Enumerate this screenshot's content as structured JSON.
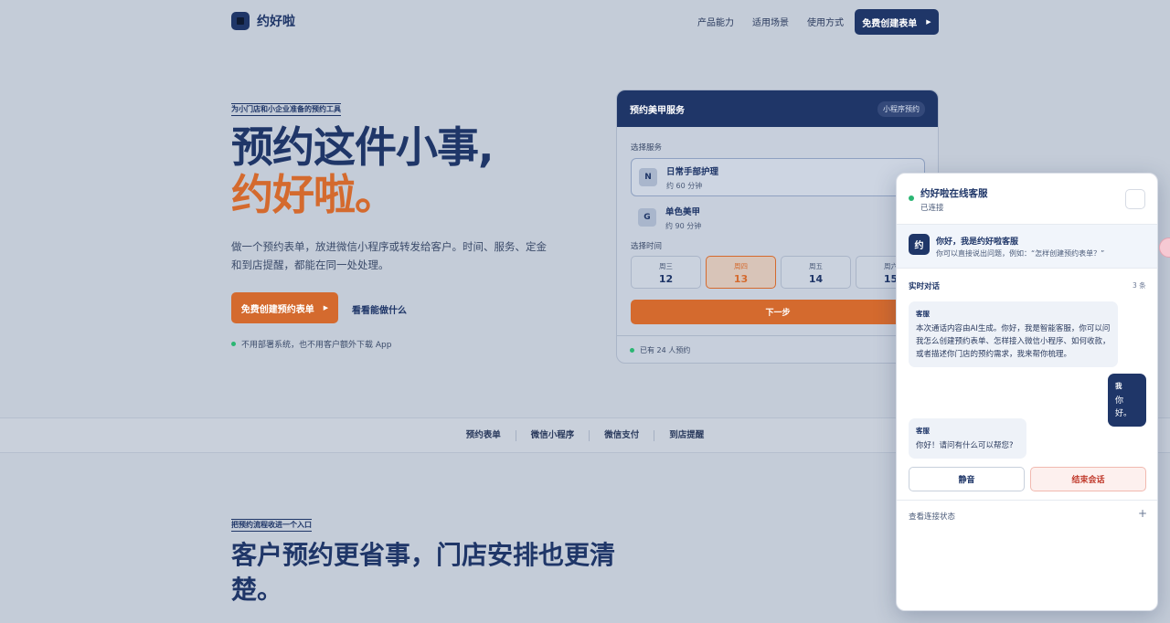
{
  "nav": {
    "brand": "约好啦",
    "links": [
      "产品能力",
      "适用场景",
      "使用方式"
    ],
    "cta": "免费创建表单"
  },
  "hero": {
    "eyebrow": "为小门店和小企业准备的预约工具",
    "title_line1": "预约这件小事,",
    "title_line2": "约好啦。",
    "lead": "做一个预约表单，放进微信小程序或转发给客户。时间、服务、定金和到店提醒，都能在同一处处理。",
    "cta_primary": "免费创建预约表单",
    "cta_link": "看看能做什么",
    "note": "不用部署系统，也不用客户额外下载 App"
  },
  "booking_card": {
    "title": "预约美甲服务",
    "pill": "小程序预约",
    "service_label": "选择服务",
    "services": [
      {
        "icon": "N",
        "name": "日常手部护理",
        "duration": "约 60 分钟"
      },
      {
        "icon": "G",
        "name": "单色美甲",
        "duration": "约 90 分钟"
      }
    ],
    "time_label": "选择时间",
    "days": [
      {
        "weekday": "周三",
        "date": "12"
      },
      {
        "weekday": "周四",
        "date": "13"
      },
      {
        "weekday": "周五",
        "date": "14"
      },
      {
        "weekday": "周六",
        "date": "15"
      }
    ],
    "selected_day": "13",
    "next": "下一步",
    "footer": "已有 24 人预约"
  },
  "strip": [
    "预约表单",
    "微信小程序",
    "微信支付",
    "到店提醒"
  ],
  "section2": {
    "eyebrow": "把预约流程收进一个入口",
    "title": "客户预约更省事，门店安排也更清楚。"
  },
  "chat": {
    "title": "约好啦在线客服",
    "status": "已连接",
    "intro_avatar": "约",
    "intro_title": "你好，我是约好啦客服",
    "intro_sub": "你可以直接说出问题，例如：“怎样创建预约表单？”",
    "realtime_label": "实时对话",
    "count": "3 条",
    "messages": [
      {
        "who": "客服",
        "text": "本次通话内容由AI生成。你好，我是智能客服，你可以问我怎么创建预约表单、怎样接入微信小程序、如何收款，或者描述你门店的预约需求，我来帮你梳理。"
      },
      {
        "who": "我",
        "text": "你好。"
      },
      {
        "who": "客服",
        "text": "你好！请问有什么可以帮您?"
      }
    ],
    "mute": "静音",
    "end": "结束会话",
    "conn_status": "查看连接状态",
    "plus": "+"
  },
  "colors": {
    "navy": "#1f3668",
    "accent": "#d46a2e",
    "online": "#2bb673",
    "danger": "#c0392b"
  }
}
